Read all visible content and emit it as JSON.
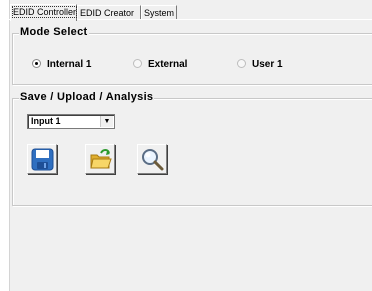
{
  "tabs": [
    {
      "label": "EDID Controller",
      "active": true
    },
    {
      "label": "EDID Creator",
      "active": false
    },
    {
      "label": "System",
      "active": false
    }
  ],
  "mode_select": {
    "title": "Mode Select",
    "options": [
      {
        "label": "Internal 1",
        "selected": true
      },
      {
        "label": "External",
        "selected": false
      },
      {
        "label": "User 1",
        "selected": false
      }
    ]
  },
  "save_group": {
    "title": "Save / Upload / Analysis",
    "input_select": {
      "value": "Input 1"
    },
    "buttons": [
      {
        "icon": "save-floppy-icon"
      },
      {
        "icon": "open-folder-icon"
      },
      {
        "icon": "magnifier-icon"
      }
    ]
  },
  "colors": {
    "panel_bg": "#f0f0f0",
    "floppy_blue": "#2f6fc0",
    "folder_yellow": "#f2c94c",
    "green_arrow": "#2e9a2e"
  }
}
